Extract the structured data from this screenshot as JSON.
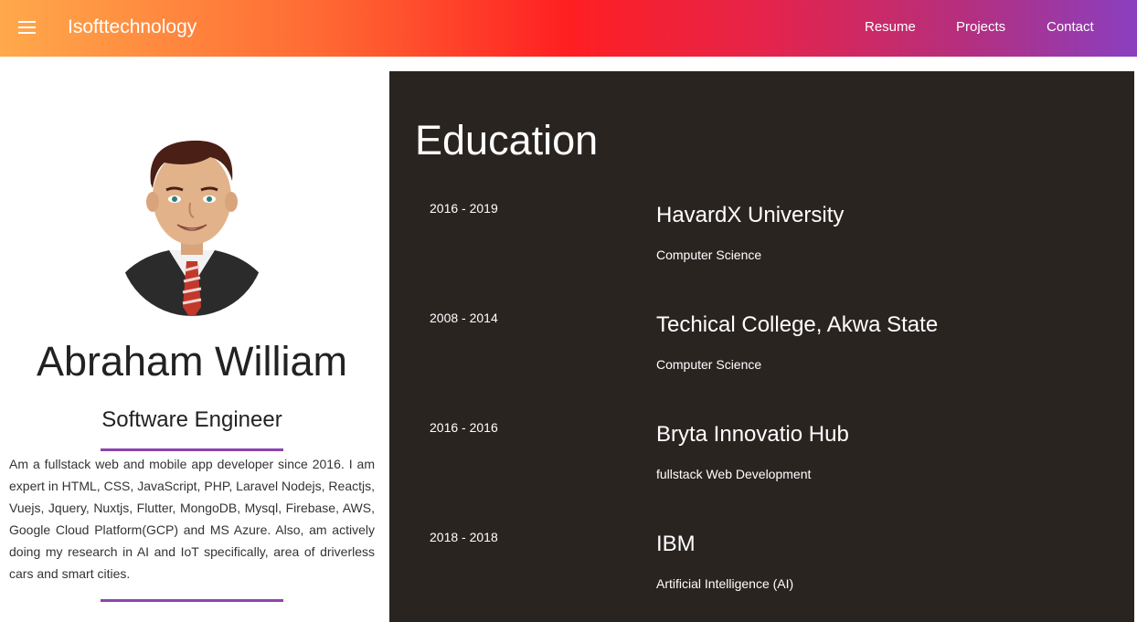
{
  "header": {
    "brand": "Isofttechnology",
    "nav": [
      "Resume",
      "Projects",
      "Contact"
    ]
  },
  "profile": {
    "name": "Abraham William",
    "role": "Software Engineer",
    "bio": "Am a fullstack web and mobile app developer since 2016. I am expert in HTML, CSS, JavaScript, PHP, Laravel Nodejs, Reactjs, Vuejs, Jquery, Nuxtjs, Flutter, MongoDB, Mysql, Firebase, AWS, Google Cloud Platform(GCP) and MS Azure. Also, am actively doing my research in AI and IoT specifically, area of driverless cars and smart cities."
  },
  "education": {
    "title": "Education",
    "entries": [
      {
        "years": "2016 - 2019",
        "school": "HavardX University",
        "field": "Computer Science"
      },
      {
        "years": "2008 - 2014",
        "school": "Techical College, Akwa State",
        "field": "Computer Science"
      },
      {
        "years": "2016 - 2016",
        "school": "Bryta Innovatio Hub",
        "field": "fullstack Web Development"
      },
      {
        "years": "2018 - 2018",
        "school": "IBM",
        "field": "Artificial Intelligence (AI)"
      }
    ]
  },
  "colors": {
    "accent": "#8e44ad",
    "panel": "#2a2421"
  },
  "icons": {
    "menu": "hamburger-menu-icon"
  }
}
